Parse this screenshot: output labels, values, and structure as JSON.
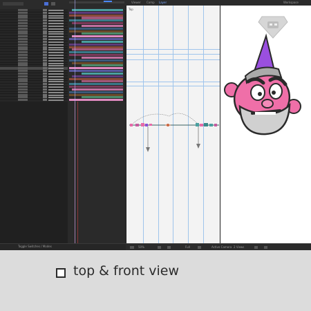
{
  "viewer": {
    "tabs": [
      "Viewer",
      "Comp",
      "Layer"
    ],
    "view_label": "Top",
    "status": {
      "zoom": "50%",
      "quality": "Full",
      "view": "Active Camera",
      "views": "2 Views"
    },
    "top_right_text": "Workspace"
  },
  "timeline": {
    "status_text": "Toggle Switches / Modes",
    "layer_count": 35
  },
  "caption": {
    "text": "top & front view",
    "checkbox_checked": false
  },
  "colors": {
    "pink": "#e86aa8",
    "teal": "#4aa0a0",
    "orange": "#c8643c",
    "violet": "#8a4fd6",
    "guide": "#9ec4ec"
  },
  "icons": [
    "checkbox-icon",
    "superman-logo-icon",
    "cartoon-face-icon",
    "null-object-icon"
  ]
}
